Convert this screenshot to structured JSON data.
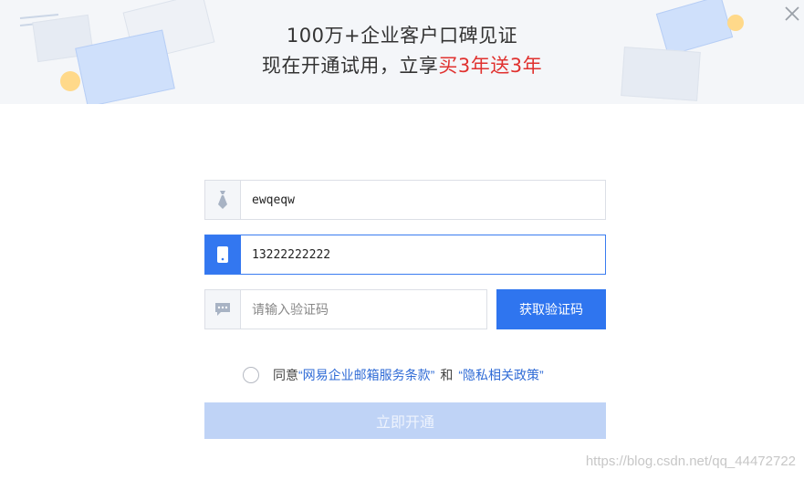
{
  "banner": {
    "line1": "100万+企业客户口碑见证",
    "line2_prefix": "现在开通试用，立享",
    "line2_highlight": "买3年送3年",
    "highlight_color": "#e0312f"
  },
  "form": {
    "name_value": "ewqeqw",
    "phone_value": "13222222222",
    "code_placeholder": "请输入验证码",
    "get_code_label": "获取验证码",
    "accent_color": "#2f75ef"
  },
  "agreement": {
    "prefix": "同意",
    "terms_link": "“网易企业邮箱服务条款”",
    "separator": "和",
    "privacy_link": "“隐私相关政策”"
  },
  "submit_label": "立即开通",
  "watermark": "https://blog.csdn.net/qq_44472722",
  "icons": {
    "close": "close-icon",
    "name": "tie-icon",
    "phone": "phone-icon",
    "code": "chat-bubble-icon"
  }
}
